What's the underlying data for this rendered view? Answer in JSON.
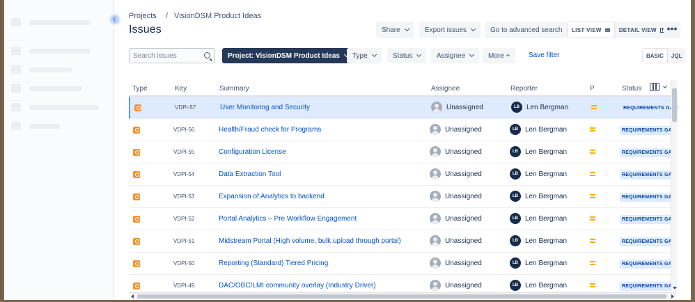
{
  "breadcrumb": {
    "projects": "Projects",
    "sep": "/",
    "project": "VisionDSM Product Ideas"
  },
  "page": {
    "title": "Issues"
  },
  "toolbar": {
    "share": "Share",
    "export": "Export issues",
    "advanced": "Go to advanced search",
    "list_view": "LIST VIEW",
    "detail_view": "DETAIL VIEW",
    "more": "•••"
  },
  "filters": {
    "search_placeholder": "Search issues",
    "project": "Project: VisionDSM Product Ideas",
    "type": "Type",
    "status": "Status",
    "assignee": "Assignee",
    "more": "More +",
    "save": "Save filter",
    "basic": "BASIC",
    "jql": "JQL"
  },
  "columns": {
    "type": "Type",
    "key": "Key",
    "summary": "Summary",
    "assignee": "Assignee",
    "reporter": "Reporter",
    "priority": "P",
    "status": "Status"
  },
  "rows": [
    {
      "key": "VDPI-57",
      "summary": "User Monitoring and Security",
      "assignee": "Unassigned",
      "reporter_initials": "LB",
      "reporter": "Len Bergman",
      "status": "REQUIREMENTS GATHERING",
      "selected": true
    },
    {
      "key": "VDPI-56",
      "summary": "Health/Fraud check for Programs",
      "assignee": "Unassigned",
      "reporter_initials": "LB",
      "reporter": "Len Bergman",
      "status": "REQUIREMENTS GATHERING"
    },
    {
      "key": "VDPI-55",
      "summary": "Configuration License",
      "assignee": "Unassigned",
      "reporter_initials": "LB",
      "reporter": "Len Bergman",
      "status": "REQUIREMENTS GATHERING"
    },
    {
      "key": "VDPI-54",
      "summary": "Data Extraction Tool",
      "assignee": "Unassigned",
      "reporter_initials": "LB",
      "reporter": "Len Bergman",
      "status": "REQUIREMENTS GATHERING"
    },
    {
      "key": "VDPI-53",
      "summary": "Expansion of Analytics to backend",
      "assignee": "Unassigned",
      "reporter_initials": "LB",
      "reporter": "Len Bergman",
      "status": "REQUIREMENTS GATHERING"
    },
    {
      "key": "VDPI-52",
      "summary": "Portal Analytics – Pre Workflow Engagement",
      "assignee": "Unassigned",
      "reporter_initials": "LB",
      "reporter": "Len Bergman",
      "status": "REQUIREMENTS GATHERING"
    },
    {
      "key": "VDPI-51",
      "summary": "Midstream Portal (High volume, bulk upload through portal)",
      "assignee": "Unassigned",
      "reporter_initials": "LB",
      "reporter": "Len Bergman",
      "status": "REQUIREMENTS GATHERING"
    },
    {
      "key": "VDPI-50",
      "summary": "Reporting (Standard) Tiered Pricing",
      "assignee": "Unassigned",
      "reporter_initials": "LB",
      "reporter": "Len Bergman",
      "status": "REQUIREMENTS GATHERING"
    },
    {
      "key": "VDPI-49",
      "summary": "DAC/OBC/LMI community overlay (Industry Driver)",
      "assignee": "Unassigned",
      "reporter_initials": "LB",
      "reporter": "Len Bergman",
      "status": "REQUIREMENTS GATHERING"
    }
  ],
  "icons": {
    "type": "idea-icon",
    "priority": "priority-medium-icon",
    "assignee": "unassigned-avatar-icon"
  },
  "colors": {
    "accent": "#0052cc",
    "project_button": "#253858",
    "type_icon": "#f79232",
    "priority": "#ffab00",
    "status_bg": "#deebff",
    "selected_row": "#deebff"
  }
}
